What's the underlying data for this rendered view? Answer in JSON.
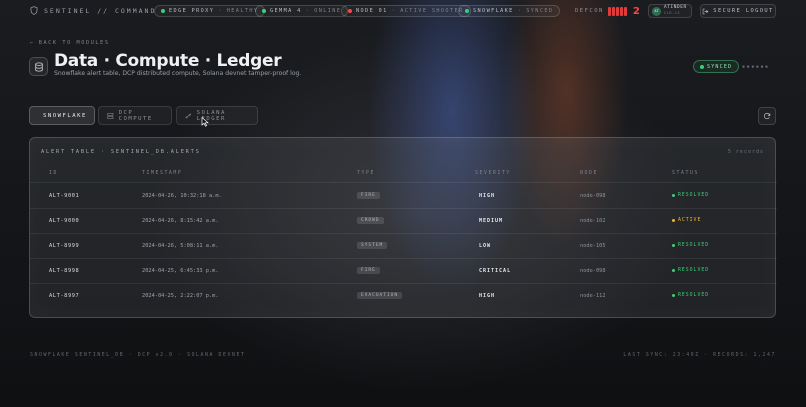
{
  "topbar": {
    "brand": "SENTINEL // COMMAND",
    "pills": [
      {
        "label": "EDGE PROXY",
        "status": "HEALTHY",
        "color": "#3ecf75"
      },
      {
        "label": "GEMMA 4",
        "status": "ONLINE",
        "color": "#3ecf75"
      },
      {
        "label": "NODE 01",
        "status": "ACTIVE SHOOTER",
        "color": "#ff4545"
      },
      {
        "label": "SNOWFLAKE",
        "status": "SYNCED",
        "color": "#3ecf75"
      }
    ],
    "defcon_label": "DEFCON",
    "defcon_level": "2",
    "user": {
      "initials": "AT",
      "name": "ATINDER",
      "clearance": "CLR-L3"
    },
    "logout_label": "SECURE LOGOUT"
  },
  "header": {
    "back_label": "BACK TO MODULES",
    "title": "Data · Compute · Ledger",
    "subtitle": "Snowflake alert table, DCP distributed compute, Solana devnet tamper-proof log.",
    "sync_status": "SYNCED",
    "code": "▪▪▪▪▪▪"
  },
  "tabs": [
    {
      "label": "SNOWFLAKE",
      "icon": "snowflake-icon",
      "active": true
    },
    {
      "label": "DCP COMPUTE",
      "icon": "server-icon",
      "active": false
    },
    {
      "label": "SOLANA LEDGER",
      "icon": "link-icon",
      "active": false
    }
  ],
  "table": {
    "title": "ALERT TABLE · SENTINEL_DB.ALERTS",
    "count": "5 records",
    "columns": [
      "ID",
      "TIMESTAMP",
      "TYPE",
      "SEVERITY",
      "NODE",
      "STATUS"
    ],
    "rows": [
      {
        "id": "ALT-9001",
        "timestamp": "2024-04-26, 10:32:18 a.m.",
        "type": "FIRE",
        "severity": "HIGH",
        "node": "node-098",
        "status": "RESOLVED",
        "status_color": "#3ecf75"
      },
      {
        "id": "ALT-9000",
        "timestamp": "2024-04-26, 8:15:42 a.m.",
        "type": "CROWD",
        "severity": "MEDIUM",
        "node": "node-102",
        "status": "ACTIVE",
        "status_color": "#e8b730"
      },
      {
        "id": "ALT-8999",
        "timestamp": "2024-04-26, 5:08:11 a.m.",
        "type": "SYSTEM",
        "severity": "LOW",
        "node": "node-105",
        "status": "RESOLVED",
        "status_color": "#3ecf75"
      },
      {
        "id": "ALT-8998",
        "timestamp": "2024-04-25, 6:45:33 p.m.",
        "type": "FIRE",
        "severity": "CRITICAL",
        "node": "node-098",
        "status": "RESOLVED",
        "status_color": "#3ecf75"
      },
      {
        "id": "ALT-8997",
        "timestamp": "2024-04-25, 2:22:07 p.m.",
        "type": "EVACUATION",
        "severity": "HIGH",
        "node": "node-112",
        "status": "RESOLVED",
        "status_color": "#3ecf75"
      }
    ]
  },
  "footer": {
    "left": "SNOWFLAKE SENTINEL_DB · DCP v2.0 · SOLANA DEVNET",
    "right": "LAST SYNC: 23:40Z · RECORDS: 1,247"
  }
}
